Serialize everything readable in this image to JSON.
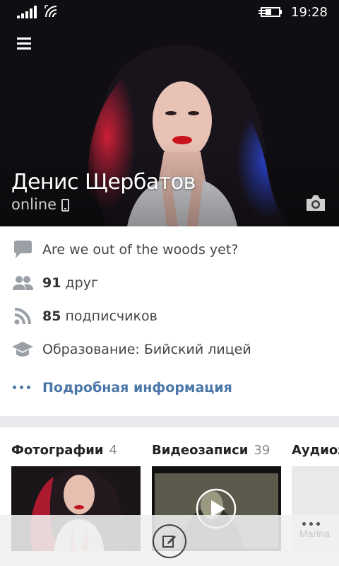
{
  "status_bar": {
    "time": "19:28",
    "icons": [
      "signal-icon",
      "wifi-icon",
      "battery-charging-icon"
    ]
  },
  "header": {
    "menu_icon": "hamburger-icon",
    "name": "Денис Щербатов",
    "online": "online",
    "camera_icon": "camera-icon"
  },
  "info": {
    "status_text": "Are we out of the woods yet?",
    "friends_count": "91",
    "friends_label": "друг",
    "followers_count": "85",
    "followers_label": "подписчиков",
    "education": "Образование: Бийский лицей",
    "more_link": "Подробная информация"
  },
  "media": {
    "photos": {
      "title": "Фотографии",
      "count": "4"
    },
    "videos": {
      "title": "Видеозаписи",
      "count": "39"
    },
    "audio": {
      "title": "Аудиоз"
    },
    "faint_text": "Marina"
  },
  "colors": {
    "accent": "#4a76a8",
    "icon_gray": "#9aa0a6",
    "separator": "#e8eaed"
  }
}
